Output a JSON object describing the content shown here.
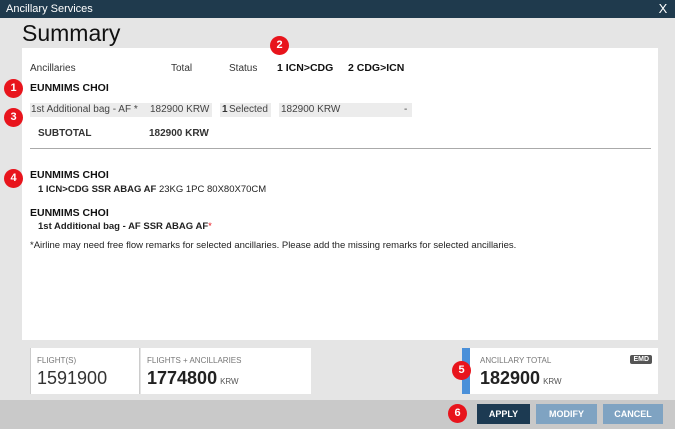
{
  "window": {
    "title": "Ancillary Services",
    "close_label": "X"
  },
  "page_title": "Summary",
  "table": {
    "headers": {
      "ancillaries": "Ancillaries",
      "total": "Total",
      "status": "Status",
      "seg1": "1 ICN>CDG",
      "seg2": "2 CDG>ICN"
    },
    "passenger_name": "EUNMIMS CHOI",
    "row": {
      "item": "1st Additional bag - AF *",
      "price": "182900 KRW",
      "count": "1",
      "status": "Selected",
      "seg1_value": "182900 KRW",
      "seg2_value": "-"
    },
    "subtotal_label": "SUBTOTAL",
    "subtotal_value": "182900 KRW"
  },
  "details": [
    {
      "name": "EUNMIMS CHOI",
      "line_bold": "1 ICN>CDG SSR ABAG AF",
      "line_rest": " 23KG 1PC 80X80X70CM"
    },
    {
      "name": "EUNMIMS CHOI",
      "line_bold": "1st Additional bag - AF SSR ABAG AF",
      "line_rest": "*"
    }
  ],
  "note": "*Airline may need free flow remarks for selected ancillaries. Please add the missing remarks for selected ancillaries.",
  "totals": {
    "flights_label": "FLIGHT(S)",
    "flights_value": "1591900",
    "flights_anc_label": "FLIGHTS + ANCILLARIES",
    "flights_anc_value": "1774800",
    "flights_anc_unit": "KRW",
    "anc_label": "ANCILLARY TOTAL",
    "anc_value": "182900",
    "anc_unit": "KRW",
    "emd_badge": "EMD"
  },
  "buttons": {
    "apply": "APPLY",
    "modify": "MODIFY",
    "cancel": "CANCEL"
  },
  "badges": [
    "1",
    "2",
    "3",
    "4",
    "5",
    "6"
  ],
  "colors": {
    "titlebar": "#1f3a4d",
    "badge": "#e8141c",
    "apply": "#1c3a52",
    "secondary_button": "#7fa3c2",
    "accent": "#4a90d9"
  }
}
